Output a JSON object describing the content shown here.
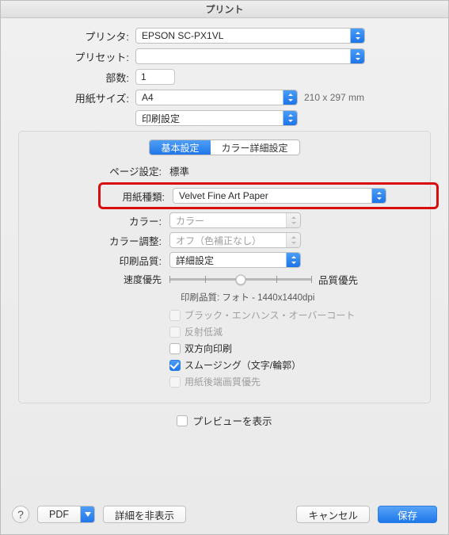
{
  "title": "プリント",
  "top": {
    "printer_label": "プリンタ:",
    "printer_value": "EPSON SC-PX1VL",
    "preset_label": "プリセット:",
    "preset_value": "",
    "copies_label": "部数:",
    "copies_value": "1",
    "papersize_label": "用紙サイズ:",
    "papersize_value": "A4",
    "dimensions": "210 x 297 mm",
    "section_value": "印刷設定"
  },
  "tabs": {
    "basic": "基本設定",
    "color": "カラー詳細設定"
  },
  "panel": {
    "page_setting_label": "ページ設定:",
    "page_setting_value": "標準",
    "media_label": "用紙種類:",
    "media_value": "Velvet Fine Art Paper",
    "color_label": "カラー:",
    "color_value": "カラー",
    "coloradj_label": "カラー調整:",
    "coloradj_value": "オフ（色補正なし）",
    "quality_label": "印刷品質:",
    "quality_value": "詳細設定",
    "speed_label": "速度優先",
    "quality_right": "品質優先",
    "dpi": "印刷品質:  フォト - 1440x1440dpi",
    "c_black": "ブラック・エンハンス・オーバーコート",
    "c_reflect": "反射低減",
    "c_bidir": "双方向印刷",
    "c_smooth": "スムージング（文字/輪郭）",
    "c_trail": "用紙後端画質優先"
  },
  "preview": "プレビューを表示",
  "footer": {
    "help": "?",
    "pdf": "PDF",
    "hide": "詳細を非表示",
    "cancel": "キャンセル",
    "save": "保存"
  }
}
